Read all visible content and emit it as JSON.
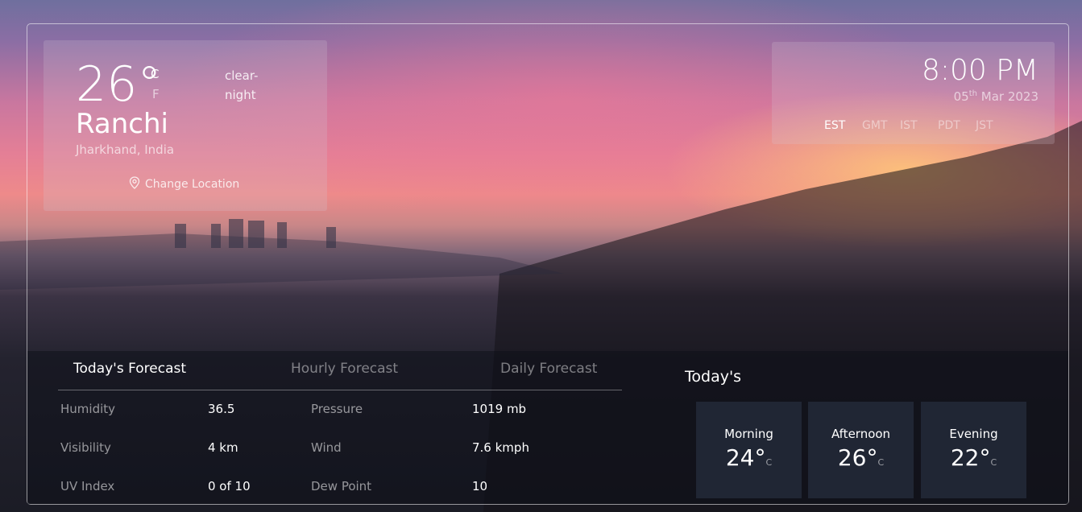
{
  "current": {
    "temperature": "26°",
    "unit_c": "C",
    "unit_f": "F",
    "condition": "clear-night",
    "city": "Ranchi",
    "region": "Jharkhand, India",
    "change_location_label": "Change Location"
  },
  "clock": {
    "time": "8:00 PM",
    "day": "05",
    "day_suffix": "th",
    "month_year": "Mar 2023",
    "timezones": [
      "EST",
      "GMT",
      "IST",
      "PDT",
      "JST"
    ],
    "active_timezone": "EST"
  },
  "forecast_tabs": {
    "today": "Today's Forecast",
    "hourly": "Hourly Forecast",
    "daily": "Daily Forecast",
    "active": "Today's Forecast"
  },
  "details": {
    "humidity_label": "Humidity",
    "humidity_value": "36.5",
    "pressure_label": "Pressure",
    "pressure_value": "1019 mb",
    "visibility_label": "Visibility",
    "visibility_value": "4 km",
    "wind_label": "Wind",
    "wind_value": "7.6 kmph",
    "uv_label": "UV Index",
    "uv_value": "0 of 10",
    "dew_label": "Dew Point",
    "dew_value": "10"
  },
  "todays": {
    "title": "Today's",
    "unit": "C",
    "morning_label": "Morning",
    "morning_value": "24°",
    "afternoon_label": "Afternoon",
    "afternoon_value": "26°",
    "evening_label": "Evening",
    "evening_value": "22°"
  }
}
